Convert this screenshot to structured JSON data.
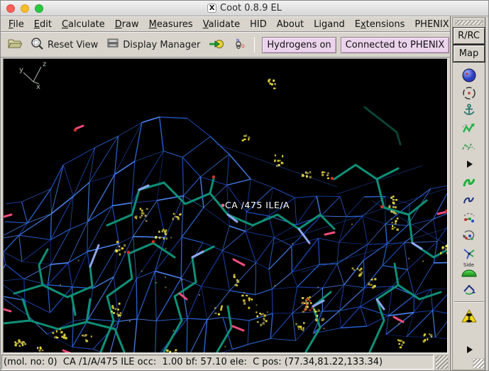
{
  "window": {
    "title": "Coot 0.8.9 EL"
  },
  "titlebar": {
    "close_button": "close",
    "minimize_button": "minimize",
    "zoom_button": "zoom",
    "app_icon": "X"
  },
  "menubar": {
    "items": [
      {
        "label": "File",
        "accel": 0
      },
      {
        "label": "Edit",
        "accel": 0
      },
      {
        "label": "Calculate",
        "accel": 0
      },
      {
        "label": "Draw",
        "accel": 0
      },
      {
        "label": "Measures",
        "accel": 0
      },
      {
        "label": "Validate",
        "accel": 0
      },
      {
        "label": "HID",
        "accel": null
      },
      {
        "label": "About",
        "accel": null
      },
      {
        "label": "Ligand",
        "accel": null
      },
      {
        "label": "Extensions",
        "accel": 1
      },
      {
        "label": "PHENIX",
        "accel": null
      }
    ]
  },
  "toolbar": {
    "reset_view_label": "Reset View",
    "display_manager_label": "Display Manager",
    "badges": [
      "Hydrogens on",
      "Connected to PHENIX"
    ]
  },
  "sidebar": {
    "buttons": [
      "R/RC",
      "Map"
    ],
    "side_label": "Side",
    "tools": [
      {
        "icon": "map-sphere-icon"
      },
      {
        "icon": "recentre-target-icon"
      },
      {
        "icon": "fix-atoms-anchor-icon"
      },
      {
        "icon": "rigid-body-fit-icon"
      },
      {
        "icon": "rot-trans-zone-icon"
      },
      {
        "icon": "expand-more-icon"
      },
      {
        "icon": "auto-fit-rotamer-icon"
      },
      {
        "icon": "rotamers-icon"
      },
      {
        "icon": "edit-chi-angles-icon"
      },
      {
        "icon": "torsion-general-icon"
      },
      {
        "icon": "mutate-residue-icon"
      },
      {
        "icon": "side-chain-180-icon",
        "label": "Side"
      },
      {
        "icon": "flip-peptide-icon"
      },
      {
        "icon": "separator"
      },
      {
        "icon": "run-refmac-hazard-icon"
      },
      {
        "icon": "spacer"
      },
      {
        "icon": "expand-more-icon"
      }
    ]
  },
  "canvas": {
    "atom_label": "CA /475 ILE/A",
    "axis_labels": {
      "x": "x",
      "y": "y",
      "z": "z"
    }
  },
  "statusbar": {
    "text": "(mol. no: 0)  CA /1/A/475 ILE occ:  1.00 bf: 57.10 ele:  C pos: (77.34,81.22,133.34)"
  },
  "colors": {
    "traffic_red": "#ff5f57",
    "traffic_yellow": "#febc2e",
    "traffic_green": "#29c73f",
    "badge_bg": "#ecd3ec",
    "mesh_blue": "#2e6ae0",
    "bonds_teal": "#0e9078",
    "nitrogen_blue": "#8fa6ee",
    "oxygen_pink": "#ee4d7d",
    "red_atom": "#d23026",
    "dots_yellow": "#d9cc3b",
    "axes_green": "#a8bfa8",
    "label_white": "#ffffff"
  }
}
